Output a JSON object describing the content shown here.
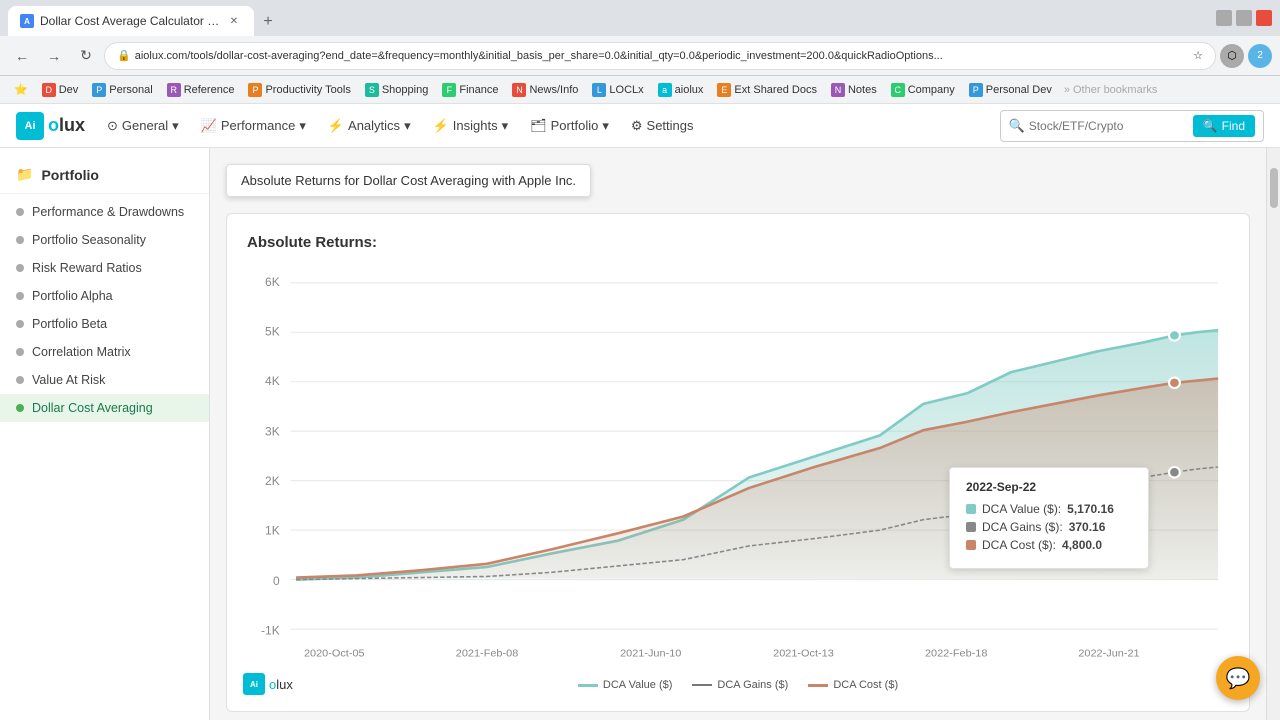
{
  "browser": {
    "tab_title": "Dollar Cost Average Calculator f...",
    "url": "aiolux.com/tools/dollar-cost-averaging?end_date=&frequency=monthly&initial_basis_per_share=0.0&initial_qty=0.0&periodic_investment=200.0&quickRadioOptions...",
    "new_tab_label": "+",
    "nav_back": "←",
    "nav_forward": "→",
    "nav_refresh": "↻",
    "bookmarks": [
      {
        "label": "Dev",
        "color": "#e74c3c"
      },
      {
        "label": "Personal",
        "color": "#3498db"
      },
      {
        "label": "Reference",
        "color": "#9b59b6"
      },
      {
        "label": "Productivity Tools",
        "color": "#e67e22"
      },
      {
        "label": "Shopping",
        "color": "#1abc9c"
      },
      {
        "label": "Finance",
        "color": "#2ecc71"
      },
      {
        "label": "News/Info",
        "color": "#e74c3c"
      },
      {
        "label": "LOCLx",
        "color": "#3498db"
      },
      {
        "label": "aiolux",
        "color": "#00bcd4"
      },
      {
        "label": "Ext Shared Docs",
        "color": "#e67e22"
      },
      {
        "label": "Notes",
        "color": "#9b59b6"
      },
      {
        "label": "Company",
        "color": "#2ecc71"
      },
      {
        "label": "Personal Dev",
        "color": "#3498db"
      },
      {
        "label": "Other bookmarks",
        "color": "#666"
      }
    ]
  },
  "app": {
    "logo_ai": "Ai",
    "logo_text_a": "o",
    "logo_text_b": "lux",
    "nav_items": [
      {
        "label": "General",
        "icon": "⊙",
        "has_arrow": true
      },
      {
        "label": "Performance",
        "icon": "📈",
        "has_arrow": true
      },
      {
        "label": "Analytics",
        "icon": "⚡",
        "has_arrow": true
      },
      {
        "label": "Insights",
        "icon": "⚡",
        "has_arrow": true
      },
      {
        "label": "Portfolio",
        "icon": "🗂",
        "has_arrow": true
      },
      {
        "label": "Settings",
        "icon": "⚙",
        "has_arrow": false
      }
    ],
    "search_placeholder": "Stock/ETF/Crypto",
    "find_label": "Find"
  },
  "sidebar": {
    "header": "Portfolio",
    "items": [
      {
        "label": "Performance & Drawdowns",
        "active": false
      },
      {
        "label": "Portfolio Seasonality",
        "active": false
      },
      {
        "label": "Risk Reward Ratios",
        "active": false
      },
      {
        "label": "Portfolio Alpha",
        "active": false
      },
      {
        "label": "Portfolio Beta",
        "active": false
      },
      {
        "label": "Correlation Matrix",
        "active": false
      },
      {
        "label": "Value At Risk",
        "active": false
      },
      {
        "label": "Dollar Cost Averaging",
        "active": true
      }
    ]
  },
  "main": {
    "tooltip_banner": "Absolute Returns for Dollar Cost Averaging with Apple Inc.",
    "chart_title": "Absolute Returns:",
    "y_labels": [
      "6K",
      "5K",
      "4K",
      "3K",
      "2K",
      "1K",
      "0",
      "-1K"
    ],
    "x_labels": [
      "2020-Oct-05",
      "2021-Feb-08",
      "2021-Jun-10",
      "2021-Oct-13",
      "2022-Feb-18",
      "2022-Jun-21"
    ],
    "tooltip": {
      "date": "2022-Sep-22",
      "dca_value_label": "DCA Value ($):",
      "dca_value": "5,170.16",
      "dca_gains_label": "DCA Gains ($):",
      "dca_gains": "370.16",
      "dca_cost_label": "DCA Cost ($):",
      "dca_cost": "4,800.0"
    },
    "legend": [
      {
        "label": "DCA Value ($)",
        "type": "dca-value"
      },
      {
        "label": "DCA Gains ($)",
        "type": "dca-gains"
      },
      {
        "label": "DCA Cost ($)",
        "type": "dca-cost"
      }
    ],
    "watermark_ai": "Ai",
    "watermark_text": "olux"
  }
}
